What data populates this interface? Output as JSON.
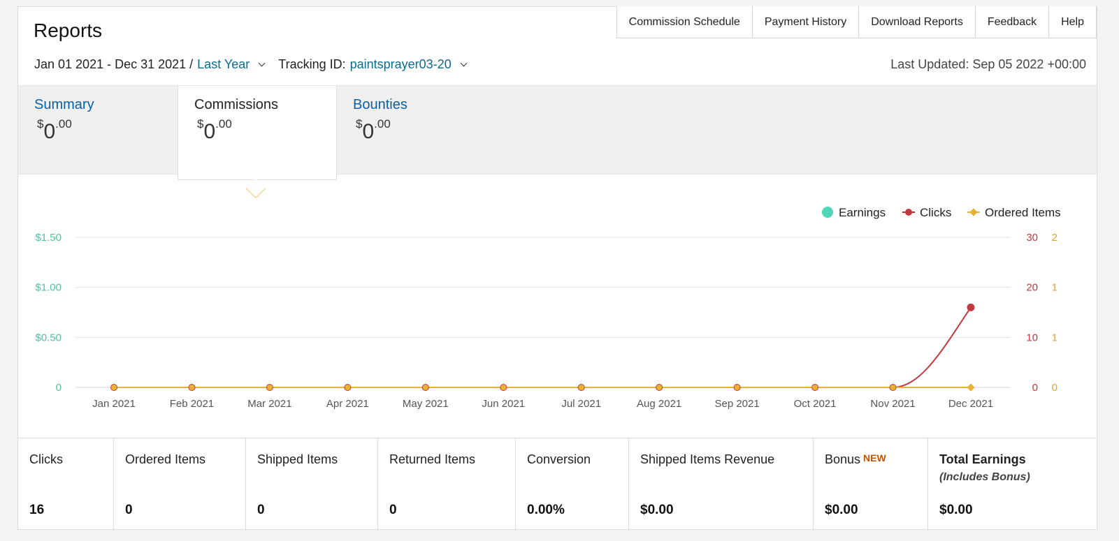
{
  "page": {
    "title": "Reports",
    "nav": [
      "Commission Schedule",
      "Payment History",
      "Download Reports",
      "Feedback",
      "Help"
    ],
    "date_range": "Jan 01 2021 - Dec 31 2021 /",
    "range_preset": "Last Year",
    "tracking_label": "Tracking ID:",
    "tracking_id": "paintsprayer03-20",
    "last_updated": "Last Updated: Sep 05 2022 +00:00"
  },
  "tabs": [
    {
      "label": "Summary",
      "currency": "$",
      "whole": "0",
      "cents": ".00"
    },
    {
      "label": "Commissions",
      "currency": "$",
      "whole": "0",
      "cents": ".00"
    },
    {
      "label": "Bounties",
      "currency": "$",
      "whole": "0",
      "cents": ".00"
    }
  ],
  "active_tab": 1,
  "colors": {
    "earnings": "#4fd6b7",
    "clicks": "#c0393f",
    "ordered": "#e9b237",
    "link": "#0b5fa5",
    "new_badge": "#c45500"
  },
  "chart_data": {
    "type": "line",
    "categories": [
      "Jan 2021",
      "Feb 2021",
      "Mar 2021",
      "Apr 2021",
      "May 2021",
      "Jun 2021",
      "Jul 2021",
      "Aug 2021",
      "Sep 2021",
      "Oct 2021",
      "Nov 2021",
      "Dec 2021"
    ],
    "legend": [
      "Earnings",
      "Clicks",
      "Ordered Items"
    ],
    "legend_position": "top-right",
    "series": [
      {
        "name": "Earnings",
        "values": [
          0,
          0,
          0,
          0,
          0,
          0,
          0,
          0,
          0,
          0,
          0,
          0
        ]
      },
      {
        "name": "Clicks",
        "values": [
          0,
          0,
          0,
          0,
          0,
          0,
          0,
          0,
          0,
          0,
          0,
          16
        ]
      },
      {
        "name": "Ordered Items",
        "values": [
          0,
          0,
          0,
          0,
          0,
          0,
          0,
          0,
          0,
          0,
          0,
          0
        ]
      }
    ],
    "y_left_ticks": [
      "0",
      "$0.50",
      "$1.00",
      "$1.50"
    ],
    "y_left_range": [
      0,
      1.5
    ],
    "y_right1_ticks": [
      "0",
      "10",
      "20",
      "30"
    ],
    "y_right1_range": [
      0,
      30
    ],
    "y_right2_ticks": [
      "0",
      "1",
      "1",
      "2"
    ],
    "y_right2_range": [
      0,
      2
    ],
    "grid": true
  },
  "stats": [
    {
      "label": "Clicks",
      "value": "16"
    },
    {
      "label": "Ordered Items",
      "value": "0"
    },
    {
      "label": "Shipped Items",
      "value": "0"
    },
    {
      "label": "Returned Items",
      "value": "0"
    },
    {
      "label": "Conversion",
      "value": "0.00%"
    },
    {
      "label": "Shipped Items Revenue",
      "value": "$0.00"
    },
    {
      "label": "Bonus",
      "badge": "NEW",
      "value": "$0.00"
    },
    {
      "label": "Total Earnings",
      "sublabel": "(Includes Bonus)",
      "value": "$0.00"
    }
  ]
}
